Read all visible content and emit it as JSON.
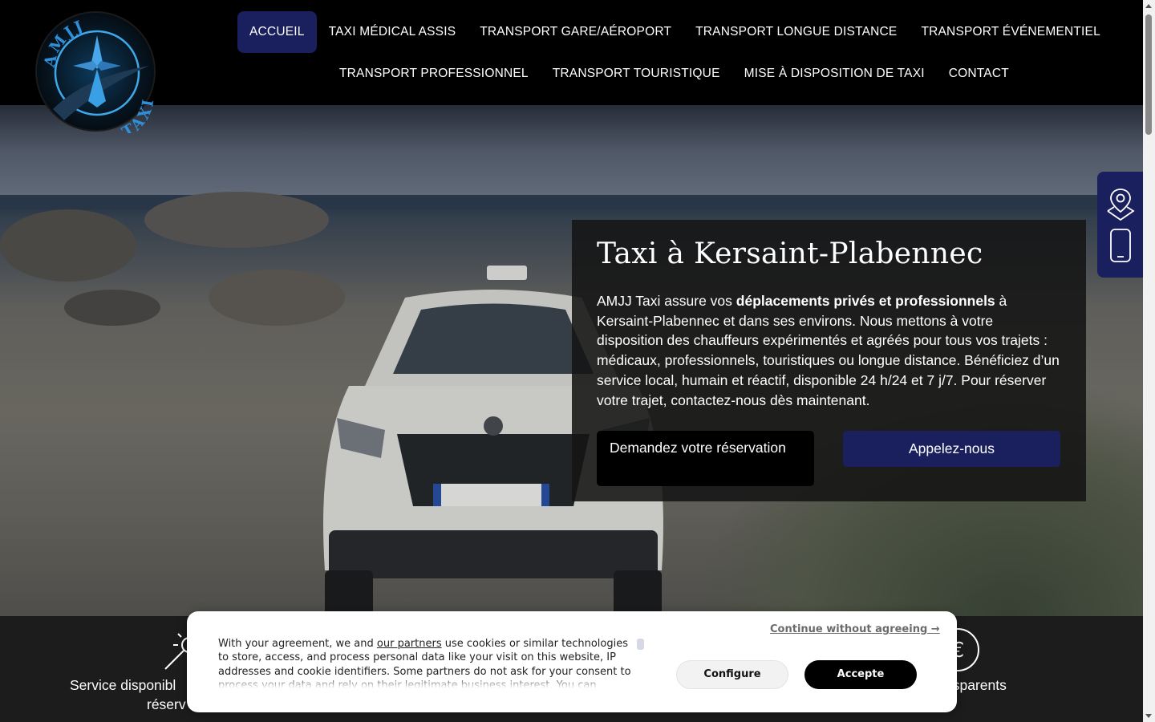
{
  "logo": {
    "text_top": "AMJJ",
    "text_bottom": "TAXI"
  },
  "nav": {
    "row1": [
      "ACCUEIL",
      "TAXI MÉDICAL ASSIS",
      "TRANSPORT GARE/AÉROPORT",
      "TRANSPORT LONGUE DISTANCE",
      "TRANSPORT ÉVÉNEMENTIEL"
    ],
    "row2": [
      "TRANSPORT PROFESSIONNEL",
      "TRANSPORT TOURISTIQUE",
      "MISE À DISPOSITION DE TAXI",
      "CONTACT"
    ],
    "active": "ACCUEIL"
  },
  "hero": {
    "title": "Taxi à Kersaint-Plabennec",
    "text_part1": "AMJJ Taxi assure vos ",
    "text_bold": "déplacements privés et professionnels",
    "text_part2": " à Kersaint-Plabennec et dans ses environs. Nous mettons à votre disposition des chauffeurs expérimentés et agréés pour tous vos trajets : médicaux, professionnels, touristiques ou longue distance. Bénéficiez d’un service local, humain et réactif, disponible 24 h/24 et 7 j/7. Pour réserver votre trajet, contactez-nous dès maintenant.",
    "btn_reservation": "Demandez votre réservation",
    "btn_call": "Appelez-nous"
  },
  "side_widget": {
    "icons": [
      "map-pin-icon",
      "phone-icon"
    ]
  },
  "features": {
    "left_line1": "Service disponibl",
    "left_line2": "réserv",
    "right_line1": "nsparents"
  },
  "cookie": {
    "text_before_link": "With your agreement, we and ",
    "link": "our partners",
    "text_after_link": " use cookies or similar technologies to store, access, and process personal data like your visit on this website, IP addresses and cookie identifiers. Some partners do not ask for your consent to process your data and rely on their legitimate business interest. You can",
    "continue": "Continue without agreeing →",
    "configure": "Configure",
    "accept": "Accepte"
  },
  "colors": {
    "brand_blue": "#1a1f5e",
    "header_bg": "#000000",
    "card_bg": "#141414"
  }
}
